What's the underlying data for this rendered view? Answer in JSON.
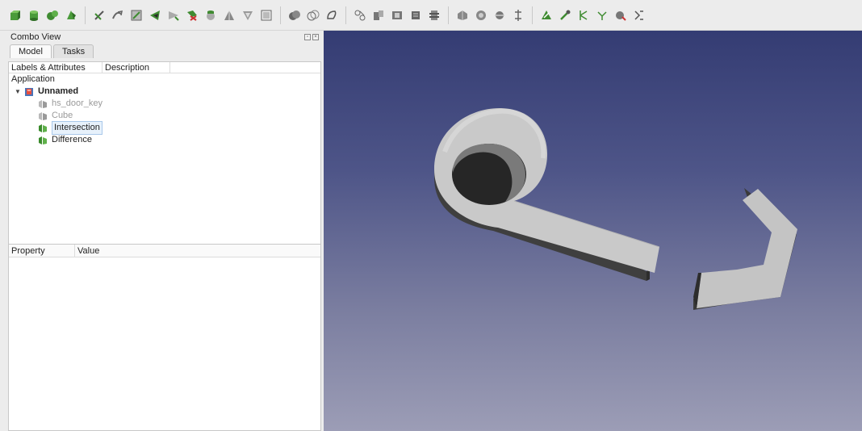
{
  "toolbar": {
    "icons": [
      "part-box-icon",
      "part-cylinder-icon",
      "part-sphere-icon",
      "part-cone-icon",
      "measure-icon",
      "mirror-icon",
      "fillet-icon",
      "extrude-icon",
      "revolve-icon",
      "chamfer-icon",
      "section-icon",
      "cross-section-icon",
      "loft-icon",
      "sweep-icon",
      "boolean-icon",
      "cut-icon",
      "fuse-icon",
      "common-icon",
      "shape-builder-icon",
      "compound-icon",
      "explode-compound-icon",
      "check-geometry-icon",
      "defeaturing-icon",
      "offset-icon",
      "thickness-icon",
      "projection-icon",
      "attachment-icon",
      "color-per-face-icon",
      "measure-linear-icon",
      "measure-angular-icon",
      "measure-refresh-icon",
      "measure-clear-icon"
    ]
  },
  "combo": {
    "title": "Combo View",
    "tabs": [
      "Model",
      "Tasks"
    ],
    "tree_headers": [
      "Labels & Attributes",
      "Description"
    ],
    "tree": {
      "root": "Application",
      "doc": "Unnamed",
      "items": [
        {
          "label": "hs_door_key",
          "state": "hidden"
        },
        {
          "label": "Cube",
          "state": "hidden"
        },
        {
          "label": "Intersection",
          "state": "selected"
        },
        {
          "label": "Difference",
          "state": "visible"
        }
      ]
    },
    "prop_headers": [
      "Property",
      "Value"
    ]
  },
  "colors": {
    "accent": "#3a8b2c",
    "view_top": "#343c73",
    "view_bottom": "#9c9db6"
  }
}
